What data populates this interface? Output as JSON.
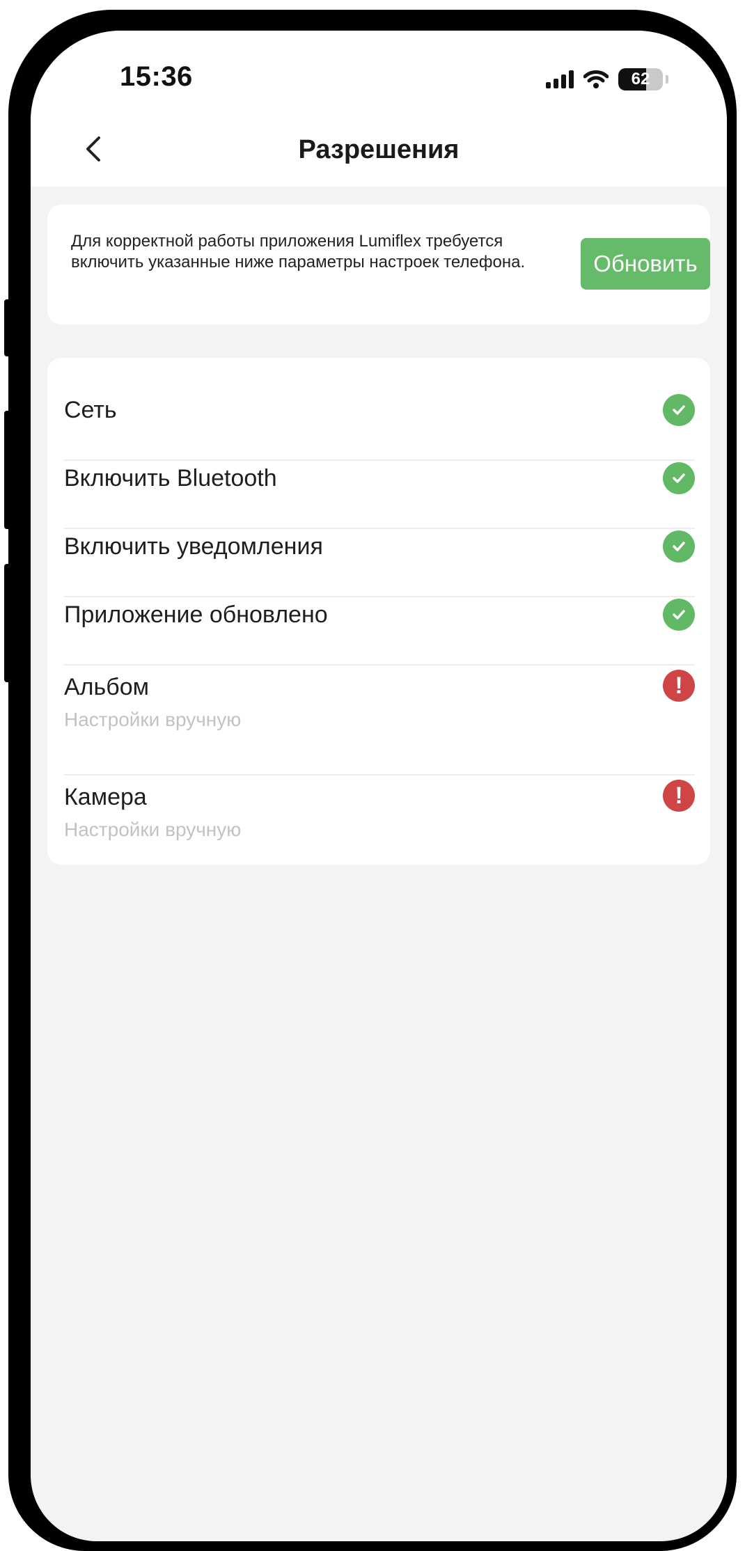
{
  "status_bar": {
    "time": "15:36",
    "battery": "62",
    "battery_level": 0.62
  },
  "nav": {
    "title": "Разрешения"
  },
  "info": {
    "text": "Для корректной работы приложения Lumiflex требуется включить указанные ниже параметры настроек телефона.",
    "button_label": "Обновить"
  },
  "permissions": [
    {
      "label": "Сеть",
      "status": "ok"
    },
    {
      "label": "Включить Bluetooth",
      "status": "ok"
    },
    {
      "label": "Включить уведомления",
      "status": "ok"
    },
    {
      "label": "Приложение обновлено",
      "status": "ok"
    },
    {
      "label": "Альбом",
      "sub": "Настройки вручную",
      "status": "error",
      "status_symbol": "!"
    },
    {
      "label": "Камера",
      "sub": "Настройки вручную",
      "status": "error",
      "status_symbol": "!"
    }
  ],
  "colors": {
    "ok": "#62b965",
    "error": "#cf4444",
    "button": "#66bb6a",
    "background": "#f3f3f3"
  }
}
